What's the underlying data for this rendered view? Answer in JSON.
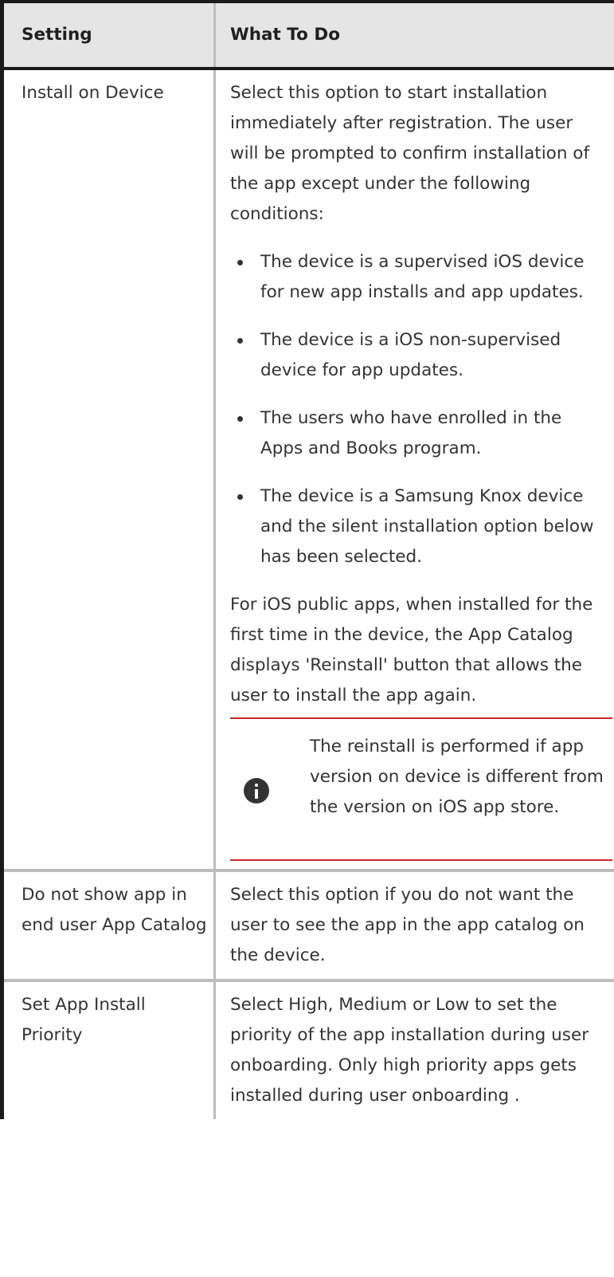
{
  "table": {
    "headers": {
      "setting": "Setting",
      "what_to_do": "What To Do"
    },
    "rows": [
      {
        "setting": "Install on Device",
        "intro": "Select this option to start installation immediately after registration. The user will be prompted to confirm installation of the app except under the following conditions:",
        "bullets": [
          "The device is a supervised iOS device for new app installs and app updates.",
          "The device is a iOS non-supervised device for app updates.",
          "The users who have enrolled in the Apps and Books program.",
          "The device is a Samsung Knox device and the silent installation option below has been selected."
        ],
        "followup": "For iOS public apps, when installed for the first time in the device, the App Catalog displays 'Reinstall' button that allows the user to install the app again.",
        "note": {
          "icon": "info-icon",
          "text": "The reinstall is performed if app version on device is different from the version on iOS app store."
        }
      },
      {
        "setting": "Do not show app in end user App Catalog",
        "description": "Select this option if you do not want the user to see the app in the app catalog on the device."
      },
      {
        "setting": "Set App Install Priority",
        "description": "Select High, Medium or Low to set the priority of the app installation during user onboarding. Only high priority apps gets installed during user onboarding ."
      }
    ]
  },
  "colors": {
    "header_bg": "#e5e5e5",
    "outer_border": "#1a1a1a",
    "inner_border": "#bdbdbd",
    "note_rule": "#c62828",
    "text": "#333333"
  }
}
